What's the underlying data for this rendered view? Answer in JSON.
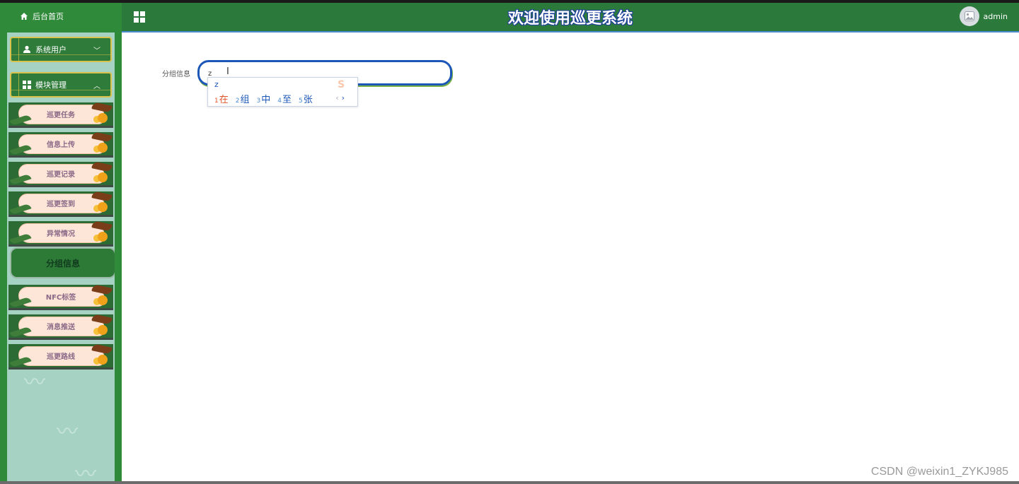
{
  "app": {
    "home_label": "后台首页",
    "title": "欢迎使用巡更系统",
    "user_name": "admin"
  },
  "sidebar": {
    "groups": [
      {
        "label": "系统用户",
        "expanded": false
      },
      {
        "label": "模块管理",
        "expanded": true
      }
    ],
    "items": [
      {
        "label": "巡更任务",
        "active": false
      },
      {
        "label": "信息上传",
        "active": false
      },
      {
        "label": "巡更记录",
        "active": false
      },
      {
        "label": "巡更签到",
        "active": false
      },
      {
        "label": "异常情况",
        "active": false
      },
      {
        "label": "分组信息",
        "active": true
      },
      {
        "label": "NFC标签",
        "active": false
      },
      {
        "label": "消息推送",
        "active": false
      },
      {
        "label": "巡更路线",
        "active": false
      }
    ]
  },
  "form": {
    "label": "分组信息",
    "value": "z"
  },
  "ime": {
    "composition": "z",
    "candidates": [
      {
        "n": "1",
        "text": "在"
      },
      {
        "n": "2",
        "text": "组"
      },
      {
        "n": "3",
        "text": "中"
      },
      {
        "n": "4",
        "text": "至"
      },
      {
        "n": "5",
        "text": "张"
      }
    ],
    "prev": "‹",
    "next": "›"
  },
  "watermark": "CSDN @weixin1_ZYKJ985",
  "colors": {
    "sidebar_green": "#2f8a3a",
    "header_green": "#2b7a3c",
    "input_border": "#1c57b8",
    "ime_highlight": "#e0542c"
  }
}
